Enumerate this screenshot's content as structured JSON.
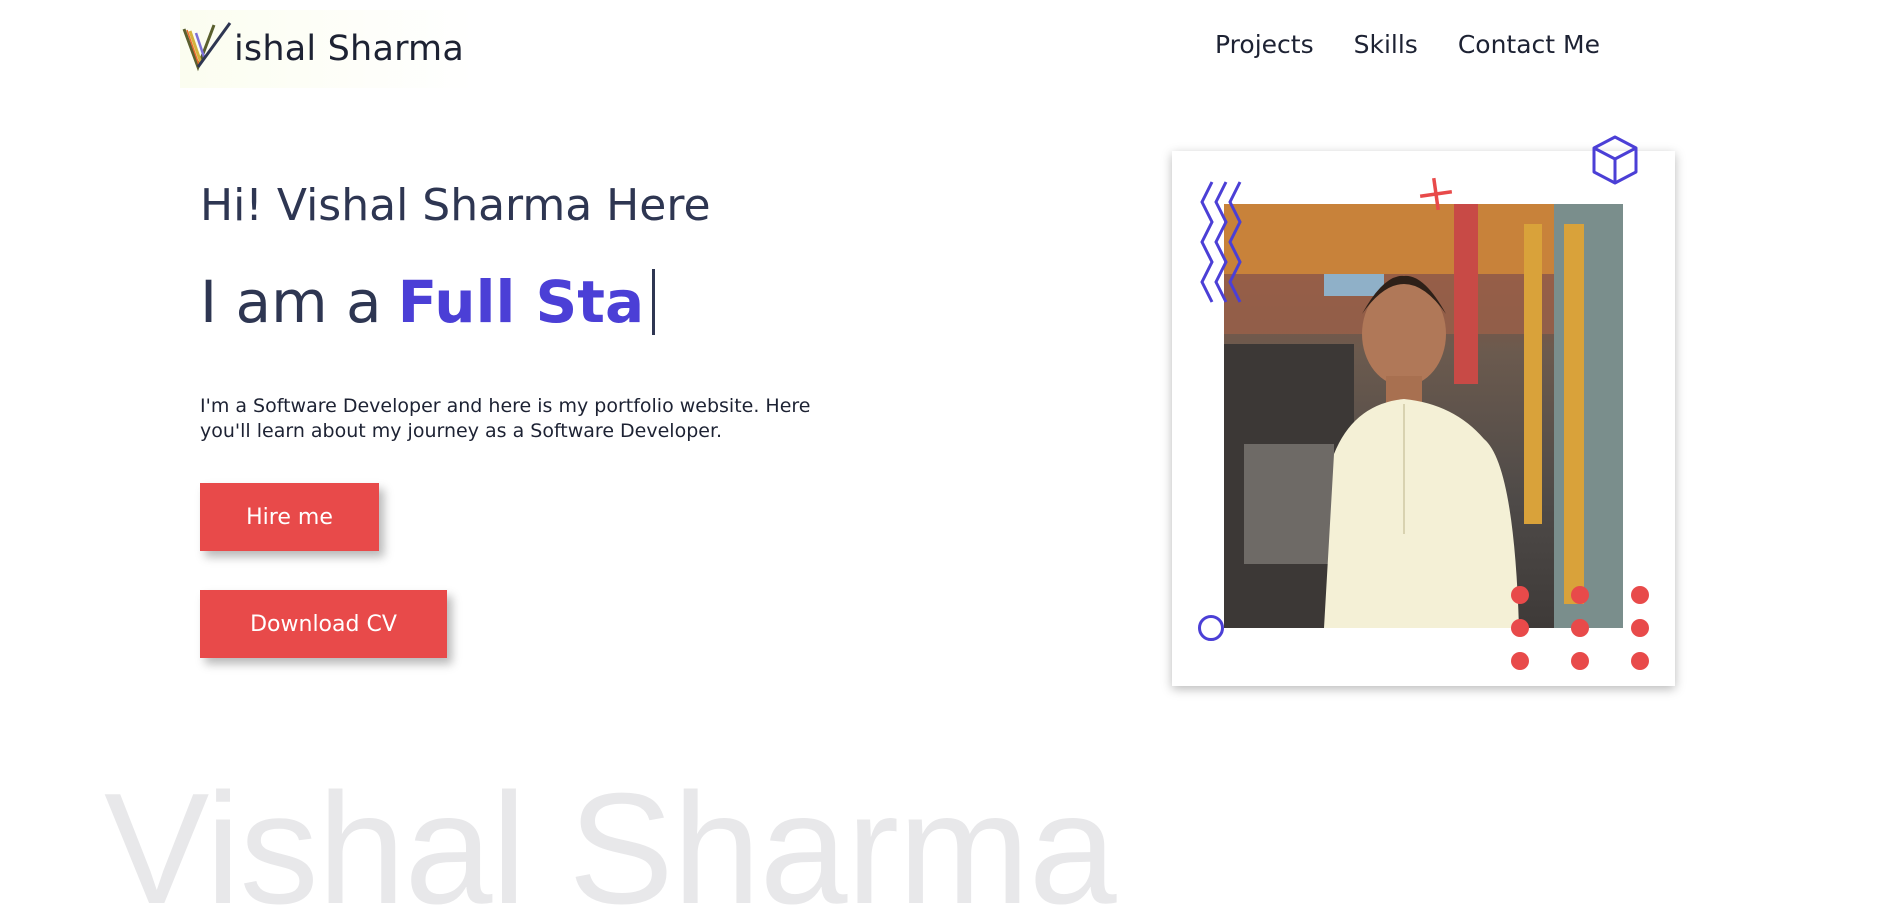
{
  "header": {
    "logo_text": "ishal Sharma",
    "nav": [
      {
        "label": "Projects"
      },
      {
        "label": "Skills"
      },
      {
        "label": "Contact Me"
      }
    ]
  },
  "hero": {
    "greeting": "Hi! Vishal Sharma Here",
    "typing_prefix": "I am a",
    "typing_role": "Full Sta",
    "intro": "I'm a Software Developer and here is my portfolio website. Here you'll learn about my journey as a Software Developer.",
    "hire_button": "Hire me",
    "cv_button": "Download CV"
  },
  "watermark": "Vishal Sharma",
  "icons": {
    "logo": "v-logo-icon",
    "zigzag": "zigzag-icon",
    "cube": "cube-icon",
    "plus": "plus-icon",
    "circle": "circle-outline-icon",
    "dots": "dot-grid-icon"
  },
  "colors": {
    "accent_red": "#e84a4a",
    "accent_purple": "#4b3fd6",
    "text_dark": "#2e3652",
    "watermark": "#e8e8ea"
  }
}
